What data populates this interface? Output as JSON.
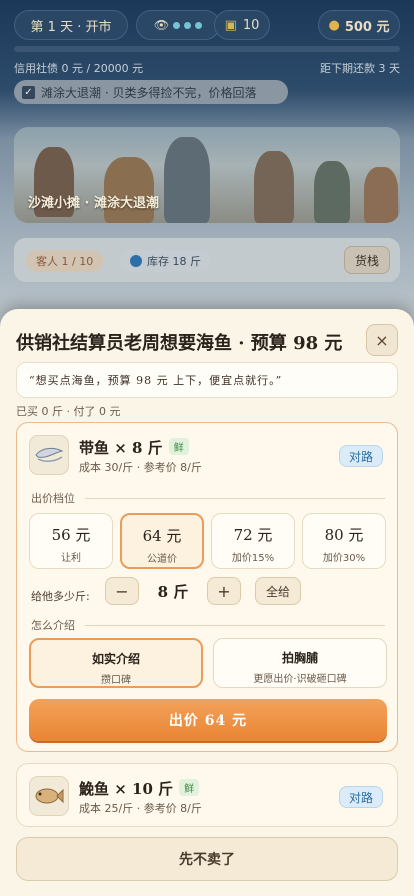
{
  "hud": {
    "day": "第 1 天 · 开市",
    "reputation_level": 3,
    "coupons": "10",
    "money": "500 元",
    "credit": "信用社债 0 元 / 20000 元",
    "due": "距下期还款 3 天",
    "news": "滩涂大退潮 · 贝类多得捡不完，价格回落",
    "scene_caption": "沙滩小摊 · 滩涂大退潮",
    "guests": "客人 1 / 10",
    "stock": "库存 18 斤",
    "goods_button": "货栈"
  },
  "modal": {
    "title": "供销社结算员老周想要海鱼 · 预算 98 元",
    "close": "×",
    "quote": "“想买点海鱼，预算 98 元 上下，便宜点就行。”",
    "bought": "已买 0 斤 · 付了 0 元",
    "item1": {
      "name": "带鱼 × 8 斤",
      "fresh": "鲜",
      "sub": "成本 30/斤 · 参考价 8/斤",
      "tag": "对路"
    },
    "price_section": "出价档位",
    "price_options": [
      {
        "value": "56 元",
        "desc": "让利"
      },
      {
        "value": "64 元",
        "desc": "公道价"
      },
      {
        "value": "72 元",
        "desc": "加价15%"
      },
      {
        "value": "80 元",
        "desc": "加价30%"
      }
    ],
    "selected_price_index": 1,
    "qty_label": "给他多少斤:",
    "qty_minus": "−",
    "qty_value": "8 斤",
    "qty_plus": "+",
    "qty_all": "全给",
    "pitch_section": "怎么介绍",
    "pitch_options": [
      {
        "title": "如实介绍",
        "desc": "攒口碑"
      },
      {
        "title": "拍胸脯",
        "desc": "更愿出价·识破砸口碑"
      }
    ],
    "offer_button": "出价 64 元",
    "item2": {
      "name": "鮸鱼 × 10 斤",
      "fresh": "鲜",
      "sub": "成本 25/斤 · 参考价 8/斤",
      "tag": "对路"
    },
    "skip_button": "先不卖了"
  },
  "colors": {
    "accent": "#e98533",
    "selected_border": "#eb9c59",
    "tag_blue": "#2b6ea0",
    "fresh_green": "#3a8a3e"
  },
  "icons": [
    "eye-icon",
    "coupon-icon",
    "money-bag-icon",
    "checkbox-icon",
    "stock-ball-icon",
    "fish-icon"
  ]
}
